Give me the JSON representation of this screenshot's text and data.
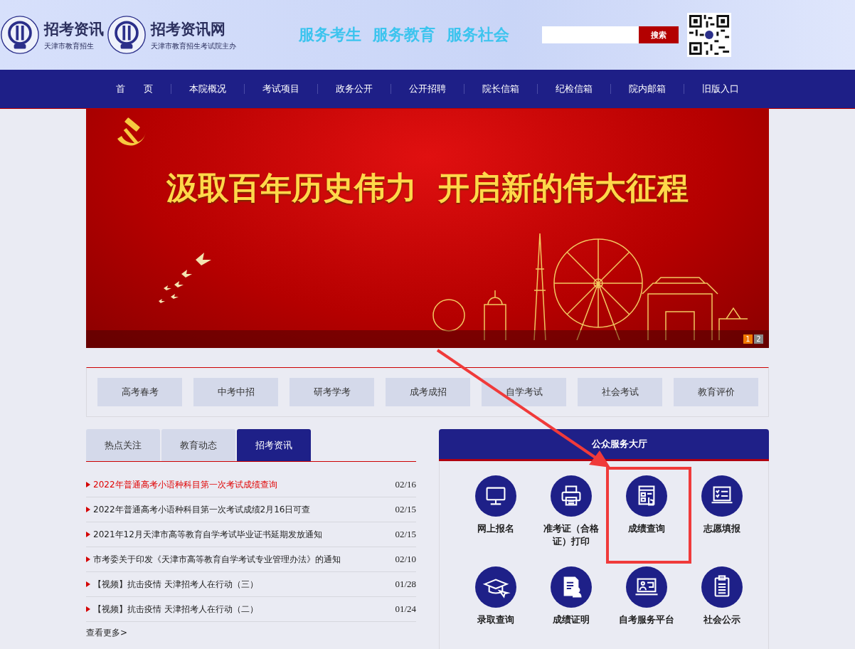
{
  "header": {
    "logos": [
      {
        "title": "招考资讯",
        "subtitle": "天津市教育招生"
      },
      {
        "title": "招考资讯网",
        "subtitle": "天津市教育招生考试院主办"
      }
    ],
    "slogans": [
      "服务考生",
      "服务教育",
      "服务社会"
    ],
    "search": {
      "button": "搜索"
    }
  },
  "nav": [
    "首　　页",
    "本院概况",
    "考试项目",
    "政务公开",
    "公开招聘",
    "院长信箱",
    "纪检信箱",
    "院内邮箱",
    "旧版入口"
  ],
  "banner": {
    "headline": "汲取百年历史伟力  开启新的伟大征程",
    "pager": [
      {
        "label": "1",
        "selected": true
      },
      {
        "label": "2",
        "selected": false
      }
    ]
  },
  "categories": [
    "高考春考",
    "中考中招",
    "研考学考",
    "成考成招",
    "自学考试",
    "社会考试",
    "教育评价"
  ],
  "news": {
    "tabs": [
      {
        "label": "热点关注",
        "selected": false
      },
      {
        "label": "教育动态",
        "selected": false
      },
      {
        "label": "招考资讯",
        "selected": true
      }
    ],
    "items": [
      {
        "title": "2022年普通高考小语种科目第一次考试成绩查询",
        "date": "02/16",
        "highlighted": true
      },
      {
        "title": "2022年普通高考小语种科目第一次考试成绩2月16日可查",
        "date": "02/15",
        "highlighted": false
      },
      {
        "title": "2021年12月天津市高等教育自学考试毕业证书延期发放通知",
        "date": "02/15",
        "highlighted": false
      },
      {
        "title": "市考委关于印发《天津市高等教育自学考试专业管理办法》的通知",
        "date": "02/10",
        "highlighted": false
      },
      {
        "title": "【视频】抗击疫情 天津招考人在行动（三）",
        "date": "01/28",
        "highlighted": false
      },
      {
        "title": "【视频】抗击疫情 天津招考人在行动（二）",
        "date": "01/24",
        "highlighted": false
      }
    ],
    "more": "查看更多>"
  },
  "services": {
    "title": "公众服务大厅",
    "items": [
      {
        "label": "网上报名",
        "kind": "monitor",
        "highlighted": false
      },
      {
        "label": "准考证（合格证）打印",
        "kind": "printer",
        "highlighted": false
      },
      {
        "label": "成绩查询",
        "kind": "form",
        "highlighted": true
      },
      {
        "label": "志愿填报",
        "kind": "checklist",
        "highlighted": false
      },
      {
        "label": "录取查询",
        "kind": "cap",
        "highlighted": false
      },
      {
        "label": "成绩证明",
        "kind": "document",
        "highlighted": false
      },
      {
        "label": "自考服务平台",
        "kind": "screen",
        "highlighted": false
      },
      {
        "label": "社会公示",
        "kind": "clipboard",
        "highlighted": false
      }
    ]
  }
}
